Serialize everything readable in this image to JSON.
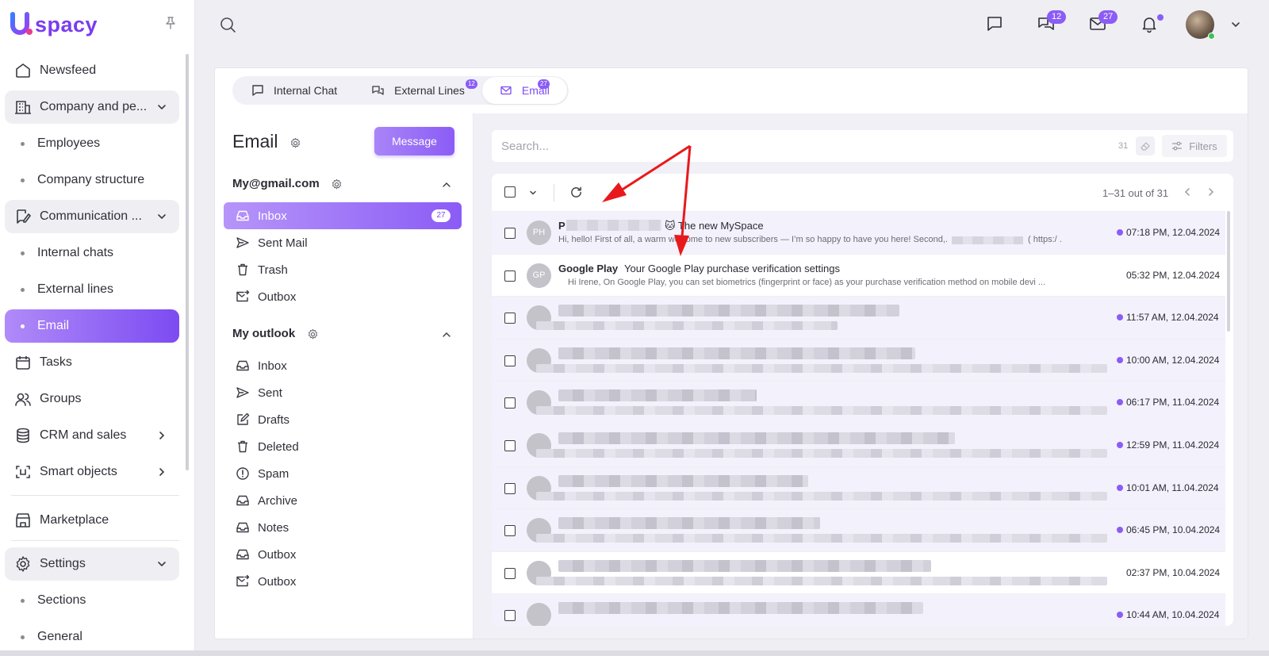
{
  "brand": {
    "name": "spacy",
    "color": "#7c4bf2"
  },
  "sidebar": {
    "items": [
      {
        "label": "Newsfeed",
        "icon": "home-icon"
      },
      {
        "label": "Company and pe...",
        "icon": "building-icon",
        "expanded": true
      },
      {
        "label": "Employees",
        "sub": true
      },
      {
        "label": "Company structure",
        "sub": true
      },
      {
        "label": "Communication ...",
        "icon": "chat-edit-icon",
        "expanded": true
      },
      {
        "label": "Internal chats",
        "sub": true
      },
      {
        "label": "External lines",
        "sub": true
      },
      {
        "label": "Email",
        "sub": true,
        "active": true
      },
      {
        "label": "Tasks",
        "icon": "calendar-icon"
      },
      {
        "label": "Groups",
        "icon": "users-icon"
      },
      {
        "label": "CRM and sales",
        "icon": "database-icon"
      },
      {
        "label": "Smart objects",
        "icon": "scan-icon"
      },
      {
        "label": "Marketplace",
        "icon": "store-icon"
      },
      {
        "label": "Settings",
        "icon": "gear-icon",
        "expanded": true
      },
      {
        "label": "Sections",
        "sub": true
      },
      {
        "label": "General",
        "sub": true
      }
    ]
  },
  "topbar": {
    "chats_badge": "12",
    "mail_badge": "27"
  },
  "tabs": [
    {
      "label": "Internal Chat",
      "badge": ""
    },
    {
      "label": "External Lines",
      "badge": "12"
    },
    {
      "label": "Email",
      "badge": "27",
      "active": true
    }
  ],
  "folders": {
    "title": "Email",
    "message_button": "Message",
    "accounts": [
      {
        "name": "My@gmail.com",
        "folders": [
          {
            "label": "Inbox",
            "icon": "inbox-icon",
            "badge": "27",
            "active": true
          },
          {
            "label": "Sent Mail",
            "icon": "send-icon"
          },
          {
            "label": "Trash",
            "icon": "trash-icon"
          },
          {
            "label": "Outbox",
            "icon": "outbox-icon"
          }
        ]
      },
      {
        "name": "My outlook",
        "folders": [
          {
            "label": "Inbox",
            "icon": "inbox-icon"
          },
          {
            "label": "Sent",
            "icon": "send-icon"
          },
          {
            "label": "Drafts",
            "icon": "drafts-icon"
          },
          {
            "label": "Deleted",
            "icon": "trash-icon"
          },
          {
            "label": "Spam",
            "icon": "spam-icon"
          },
          {
            "label": "Archive",
            "icon": "inbox-icon"
          },
          {
            "label": "Notes",
            "icon": "inbox-icon"
          },
          {
            "label": "Outbox",
            "icon": "inbox-icon"
          },
          {
            "label": "Outbox",
            "icon": "outbox-icon"
          }
        ]
      }
    ]
  },
  "mail": {
    "search_placeholder": "Search...",
    "search_count": "31",
    "filters_label": "Filters",
    "pager": "1–31 out of 31",
    "rows": [
      {
        "avatar": "PH",
        "sender": "P",
        "subject": "🐱 The new MySpace",
        "snippet": "Hi, hello! First of all, a warm welcome to new subscribers — I’m so happy to have you here! Second,...",
        "snippet_tail": "( https:/ .",
        "time": "07:18 PM, 12.04.2024",
        "unread": true
      },
      {
        "avatar": "GP",
        "sender": "Google Play",
        "subject": "Your Google Play purchase verification settings",
        "snippet": "Hi Irene,     On Google Play, you can set biometrics (fingerprint or face) as your  purchase verification method on mobile devi ...",
        "time": "05:32 PM, 12.04.2024",
        "unread": false
      },
      {
        "avatar": "",
        "time": "11:57 AM, 12.04.2024",
        "unread": true
      },
      {
        "avatar": "",
        "time": "10:00 AM, 12.04.2024",
        "unread": true
      },
      {
        "avatar": "",
        "time": "06:17 PM, 11.04.2024",
        "unread": true
      },
      {
        "avatar": "",
        "time": "12:59 PM, 11.04.2024",
        "unread": true
      },
      {
        "avatar": "",
        "time": "10:01 AM, 11.04.2024",
        "unread": true
      },
      {
        "avatar": "",
        "time": "06:45 PM, 10.04.2024",
        "unread": true
      },
      {
        "avatar": "",
        "time": "02:37 PM, 10.04.2024",
        "unread": false
      },
      {
        "avatar": "",
        "time": "10:44 AM, 10.04.2024",
        "unread": true
      }
    ]
  },
  "colors": {
    "accent": "#8b5cf6",
    "arrow": "#e8191c"
  }
}
